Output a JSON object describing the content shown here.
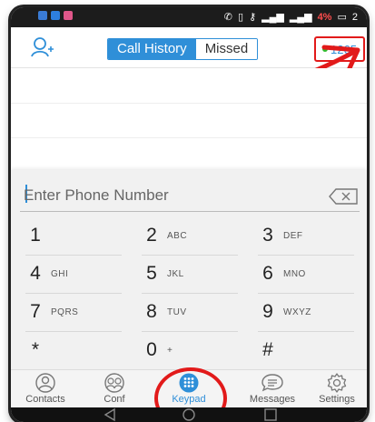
{
  "status_bar": {
    "icons": [
      "notification-icon",
      "notification-icon",
      "notification-icon"
    ],
    "right_icons": [
      "call-forward-icon",
      "vibrate-icon",
      "key-icon",
      "signal-icon",
      "signal-icon"
    ],
    "battery": "4%",
    "time": "2"
  },
  "header": {
    "tabs": [
      {
        "label": "Call History",
        "active": true
      },
      {
        "label": "Missed",
        "active": false
      }
    ],
    "credit": "1265",
    "accent_color": "#2f8fd8",
    "annotation_color": "#e21a1a"
  },
  "dialer": {
    "placeholder": "Enter Phone Number",
    "keys": [
      {
        "num": "1",
        "sub": ""
      },
      {
        "num": "2",
        "sub": "ABC"
      },
      {
        "num": "3",
        "sub": "DEF"
      },
      {
        "num": "4",
        "sub": "GHI"
      },
      {
        "num": "5",
        "sub": "JKL"
      },
      {
        "num": "6",
        "sub": "MNO"
      },
      {
        "num": "7",
        "sub": "PQRS"
      },
      {
        "num": "8",
        "sub": "TUV"
      },
      {
        "num": "9",
        "sub": "WXYZ"
      },
      {
        "num": "*",
        "sub": ""
      },
      {
        "num": "0",
        "sub": "+"
      },
      {
        "num": "#",
        "sub": ""
      }
    ]
  },
  "tabs": [
    {
      "label": "Contacts",
      "icon": "contacts-icon"
    },
    {
      "label": "Conf",
      "icon": "conference-icon"
    },
    {
      "label": "Keypad",
      "icon": "keypad-icon",
      "active": true
    },
    {
      "label": "Messages",
      "icon": "messages-icon"
    },
    {
      "label": "Settings",
      "icon": "settings-icon"
    }
  ]
}
